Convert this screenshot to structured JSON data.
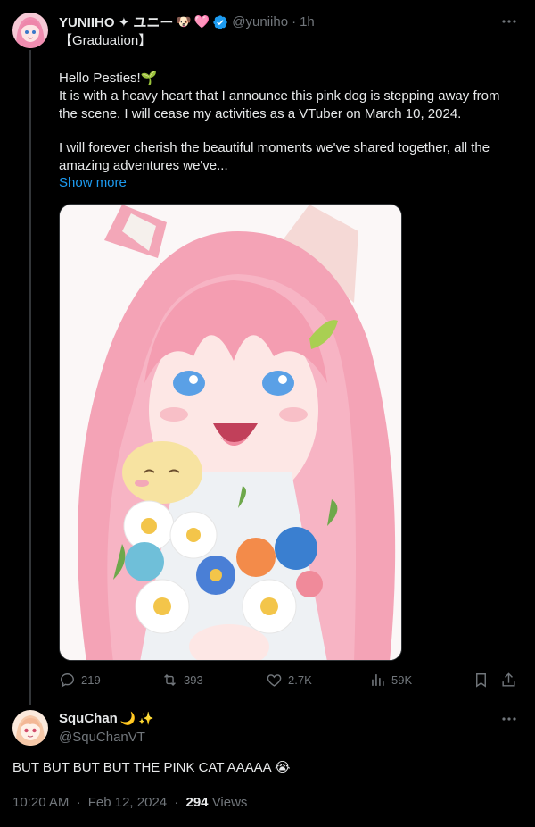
{
  "tweet": {
    "display_name": "YUNIIHO ✦ ユニー",
    "name_emojis": [
      "🐶",
      "🩷"
    ],
    "handle": "@yuniiho",
    "separator": "·",
    "time": "1h",
    "tag": "【Graduation】",
    "greeting": "Hello Pesties!🌱",
    "body_line1": "It is with a heavy heart that I announce this pink dog is stepping away from",
    "body_line2": "the scene. I will cease my activities as a VTuber on March 10, 2024.",
    "body_line3": "I will forever cherish the beautiful moments we've shared together, all the",
    "body_line4": "amazing adventures we've...",
    "show_more": "Show more",
    "actions": {
      "replies": "219",
      "reposts": "393",
      "likes": "2.7K",
      "views": "59K"
    }
  },
  "reply": {
    "display_name": "SquChan",
    "name_emojis": [
      "🌙",
      "✨"
    ],
    "handle": "@SquChanVT",
    "text": "BUT BUT BUT BUT THE PINK CAT AAAAA 😭",
    "time": "10:20 AM",
    "date": "Feb 12, 2024",
    "separator": "·",
    "views_count": "294",
    "views_label": "Views"
  },
  "colors": {
    "background": "#000000",
    "text_primary": "#e7e9ea",
    "text_secondary": "#71767b",
    "link": "#1d9bf0",
    "verified": "#1d9bf0",
    "thread_line": "#333639"
  }
}
